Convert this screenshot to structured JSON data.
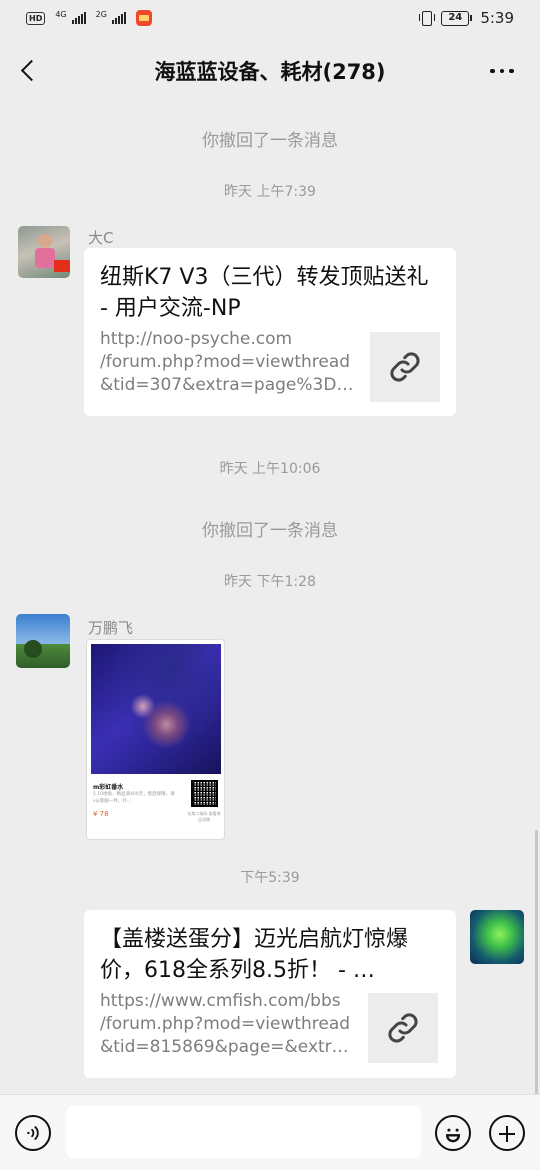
{
  "status_bar": {
    "hd": "HD",
    "signal1": "4G",
    "signal2": "2G",
    "battery": "24",
    "time": "5:39"
  },
  "header": {
    "title": "海蓝蓝设备、耗材(278)"
  },
  "messages": {
    "recall_1": "你撤回了一条消息",
    "ts_1": "昨天 上午7:39",
    "sender_1": "大C",
    "card_1": {
      "title": "纽斯K7 V3（三代）转发顶贴送礼 - 用户交流-NP",
      "url_lines": [
        "http://noo-psyche.com",
        "/forum.php?mod=viewthread",
        "&tid=307&extra=page%3D…"
      ]
    },
    "ts_2": "昨天 上午10:06",
    "recall_2": "你撤回了一条消息",
    "ts_3": "昨天 下午1:28",
    "sender_2": "万鹏飞",
    "image_card": {
      "name": "m彩虹番水",
      "desc": "5.10地角，精品滴400元，售后保障，请vip客服一件，外...",
      "price": "¥ 78",
      "qr_hint": "长按二维码 查看商品详情"
    },
    "ts_4": "下午5:39",
    "card_2": {
      "title": "【盖楼送蛋分】迈光启航灯惊爆价，618全系列8.5折！ - …",
      "url_lines": [
        "https://www.cmfish.com/bbs",
        "/forum.php?mod=viewthread",
        "&tid=815869&page=&extr…"
      ]
    }
  },
  "icons": {
    "back": "chevron-left-icon",
    "more": "more-dots-icon",
    "link": "link-icon",
    "voice": "voice-icon",
    "emoji": "emoji-icon",
    "add": "plus-icon"
  }
}
